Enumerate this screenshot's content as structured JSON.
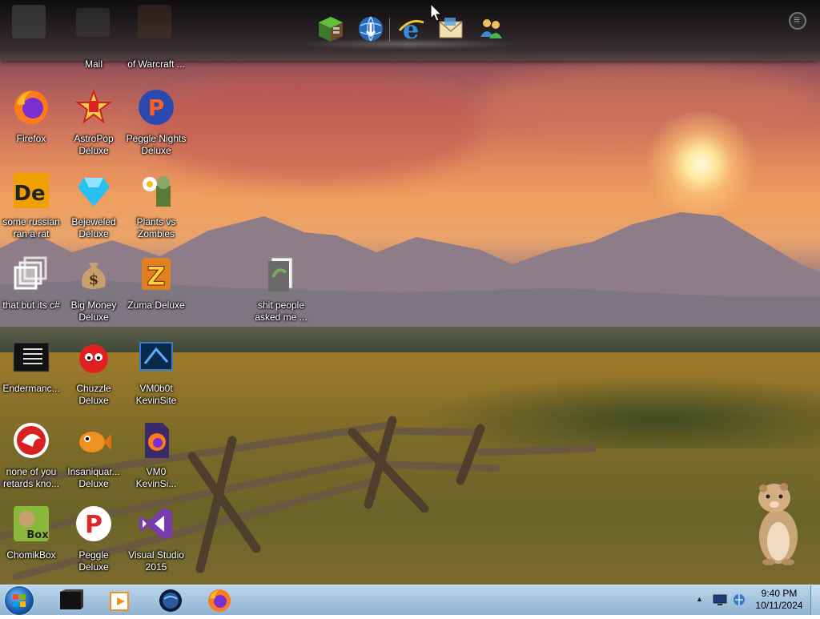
{
  "dock": {
    "items": [
      "minecraft-icon",
      "network-globe-icon",
      "internet-explorer-icon",
      "mail-icon",
      "messenger-icon"
    ],
    "menu_icon": "menu-icon"
  },
  "desktop": {
    "icons": [
      {
        "label": "Mail",
        "icon": "mail-app-icon"
      },
      {
        "label": "of Warcraft ...",
        "icon": "warcraft-icon"
      },
      {
        "label": "Firefox",
        "icon": "firefox-icon"
      },
      {
        "label": "AstroPop Deluxe",
        "icon": "astropop-icon"
      },
      {
        "label": "Peggle Nights Deluxe",
        "icon": "peggle-nights-icon"
      },
      {
        "label": "some russian ran a rat",
        "icon": "de-app-icon"
      },
      {
        "label": "Bejeweled Deluxe",
        "icon": "bejeweled-icon"
      },
      {
        "label": "Plants vs Zombies",
        "icon": "plants-vs-zombies-icon"
      },
      {
        "label": "that but its c#",
        "icon": "copy-windows-icon"
      },
      {
        "label": "Big Money Deluxe",
        "icon": "money-bag-icon"
      },
      {
        "label": "Zuma Deluxe",
        "icon": "zuma-icon"
      },
      {
        "label": "shit people asked me ...",
        "icon": "folder-icon"
      },
      {
        "label": "Endermanc...",
        "icon": "terminal-icon"
      },
      {
        "label": "Chuzzle Deluxe",
        "icon": "chuzzle-icon"
      },
      {
        "label": "VM0b0t KevinSite",
        "icon": "vm-site-icon"
      },
      {
        "label": "none of you retards kno...",
        "icon": "red-app-icon"
      },
      {
        "label": "Insaniquar... Deluxe",
        "icon": "insaniquarium-icon"
      },
      {
        "label": "VM0 KevinSi...",
        "icon": "firefox-file-icon"
      },
      {
        "label": "ChomikBox",
        "icon": "chomikbox-icon"
      },
      {
        "label": "Peggle Deluxe",
        "icon": "peggle-icon"
      },
      {
        "label": "Visual Studio 2015",
        "icon": "visual-studio-icon"
      }
    ]
  },
  "taskbar": {
    "start": "windows-start-icon",
    "pinned": [
      "terminal-app-icon",
      "media-player-icon",
      "globe-app-icon",
      "firefox-icon"
    ],
    "tray": {
      "time": "9:40 PM",
      "date": "10/11/2024",
      "icons": [
        "show-hidden-arrow-icon",
        "monitor-icon",
        "network-icon"
      ]
    }
  },
  "colors": {
    "taskbar": "#a7c6e0",
    "dock": "#1a1a1a",
    "label_text": "#ffffff"
  }
}
